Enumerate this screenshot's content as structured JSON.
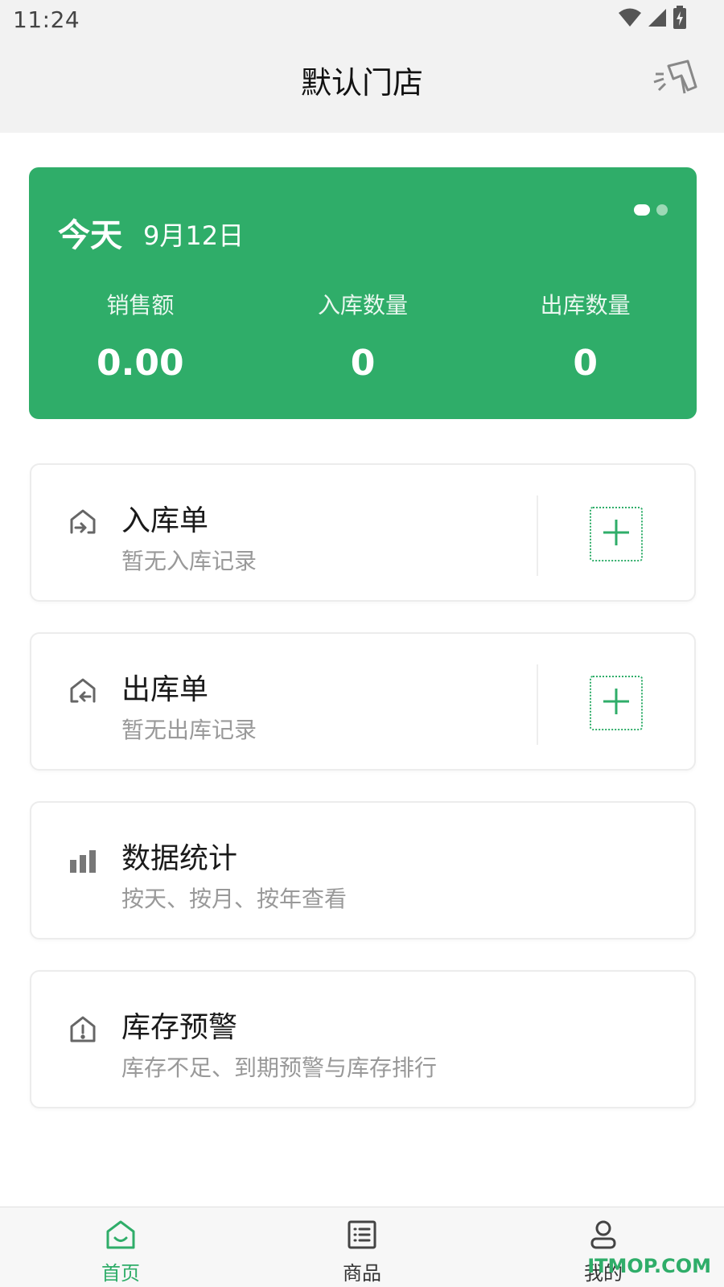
{
  "status_bar": {
    "time": "11:24"
  },
  "header": {
    "title": "默认门店"
  },
  "summary": {
    "today_label": "今天",
    "date": "9月12日",
    "stats": [
      {
        "label": "销售额",
        "value": "0.00"
      },
      {
        "label": "入库数量",
        "value": "0"
      },
      {
        "label": "出库数量",
        "value": "0"
      }
    ],
    "page_index": 1,
    "page_count": 2
  },
  "cards": [
    {
      "title": "入库单",
      "subtitle": "暂无入库记录",
      "icon": "inbound-icon",
      "has_add": true
    },
    {
      "title": "出库单",
      "subtitle": "暂无出库记录",
      "icon": "outbound-icon",
      "has_add": true
    },
    {
      "title": "数据统计",
      "subtitle": "按天、按月、按年查看",
      "icon": "bar-chart-icon",
      "has_add": false
    },
    {
      "title": "库存预警",
      "subtitle": "库存不足、到期预警与库存排行",
      "icon": "warning-house-icon",
      "has_add": false
    }
  ],
  "bottom_nav": [
    {
      "label": "首页",
      "icon": "home-icon",
      "active": true
    },
    {
      "label": "商品",
      "icon": "list-icon",
      "active": false
    },
    {
      "label": "我的",
      "icon": "user-icon",
      "active": false
    }
  ],
  "watermark": "ITMOP.COM",
  "colors": {
    "accent": "#2fad69",
    "header_bg": "#f2f2f2"
  }
}
